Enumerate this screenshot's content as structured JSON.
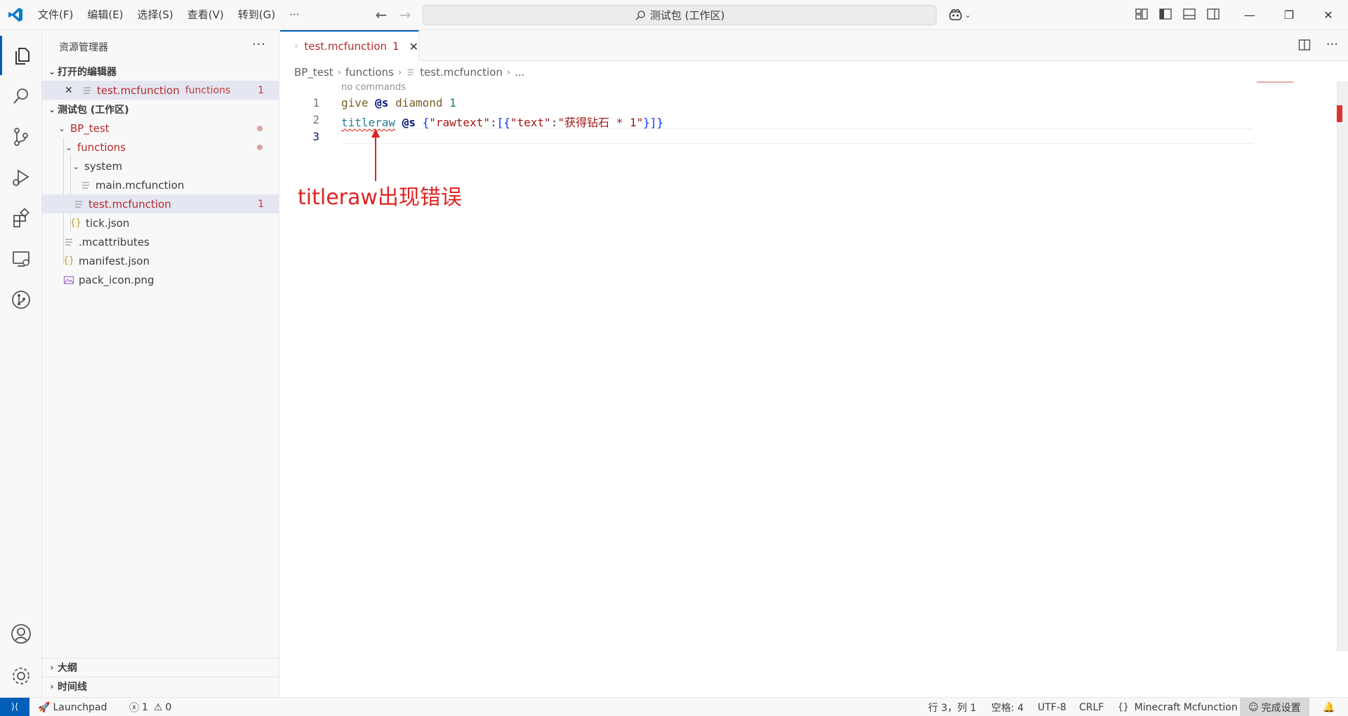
{
  "window": {
    "title": "测试包 (工作区)",
    "menu": [
      "文件(F)",
      "编辑(E)",
      "选择(S)",
      "查看(V)",
      "转到(G)",
      "···"
    ]
  },
  "sidebar": {
    "title": "资源管理器",
    "more": "···",
    "open_editors_label": "打开的编辑器",
    "open_editor": {
      "name": "test.mcfunction",
      "folder": "functions",
      "badge": "1"
    },
    "workspace_label": "测试包 (工作区)",
    "tree": {
      "bp": "BP_test",
      "functions": "functions",
      "system": "system",
      "main": "main.mcfunction",
      "test": "test.mcfunction",
      "test_badge": "1",
      "tick": "tick.json",
      "mcattributes": ".mcattributes",
      "manifest": "manifest.json",
      "pack_icon": "pack_icon.png"
    },
    "outline_label": "大纲",
    "timeline_label": "时间线"
  },
  "editor": {
    "tab": {
      "name": "test.mcfunction",
      "badge": "1"
    },
    "breadcrumb": [
      "BP_test",
      "functions",
      "test.mcfunction",
      "..."
    ],
    "codelens": "no commands",
    "line_numbers": [
      "1",
      "2",
      "3"
    ],
    "line1": {
      "cmd": "give",
      "sel": "@s",
      "item": "diamond",
      "count": "1"
    },
    "line2": {
      "cmd": "titleraw",
      "sel": "@s",
      "json_open": "{",
      "key1": "\"rawtext\"",
      "colon1": ":",
      "bracket_open": "[",
      "inner_open": "{",
      "key2": "\"text\"",
      "colon2": ":",
      "value": "\"获得钻石 * 1\"",
      "close": "}]}"
    },
    "annotation": "titleraw出现错误"
  },
  "statusbar": {
    "launchpad": "Launchpad",
    "errors": "1",
    "warnings": "0",
    "position": "行 3，列 1",
    "spaces": "空格: 4",
    "encoding": "UTF-8",
    "eol": "CRLF",
    "language": "Minecraft Mcfunction",
    "setup": "完成设置"
  },
  "colors": {
    "accent": "#005fb8",
    "error": "#e51400",
    "annotation": "#e02323"
  }
}
